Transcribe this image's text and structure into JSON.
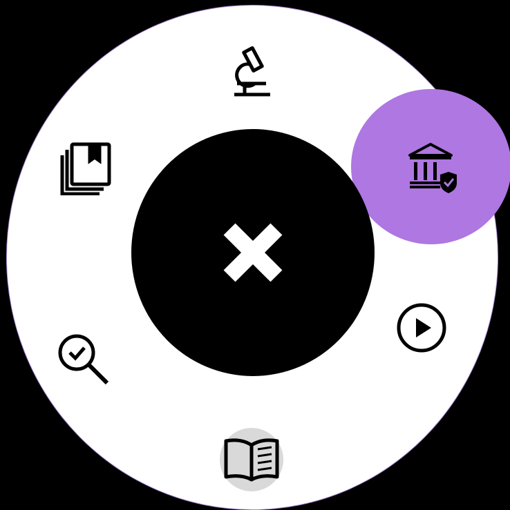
{
  "menu": {
    "center": {
      "icon": "close-icon",
      "color": "#ffffff"
    },
    "ring_color": "#ffffff",
    "ring_border_color": "#a98ad6",
    "highlight_color": "#ae77e1",
    "active_item_bg": "#d9d9d9",
    "items": [
      {
        "id": "research",
        "icon": "microscope-icon"
      },
      {
        "id": "institution",
        "icon": "bank-shield-icon",
        "highlighted": true
      },
      {
        "id": "play",
        "icon": "play-circle-icon"
      },
      {
        "id": "reading",
        "icon": "open-book-icon",
        "selected": true
      },
      {
        "id": "review",
        "icon": "search-check-icon"
      },
      {
        "id": "library",
        "icon": "bookmark-collection-icon"
      }
    ]
  }
}
